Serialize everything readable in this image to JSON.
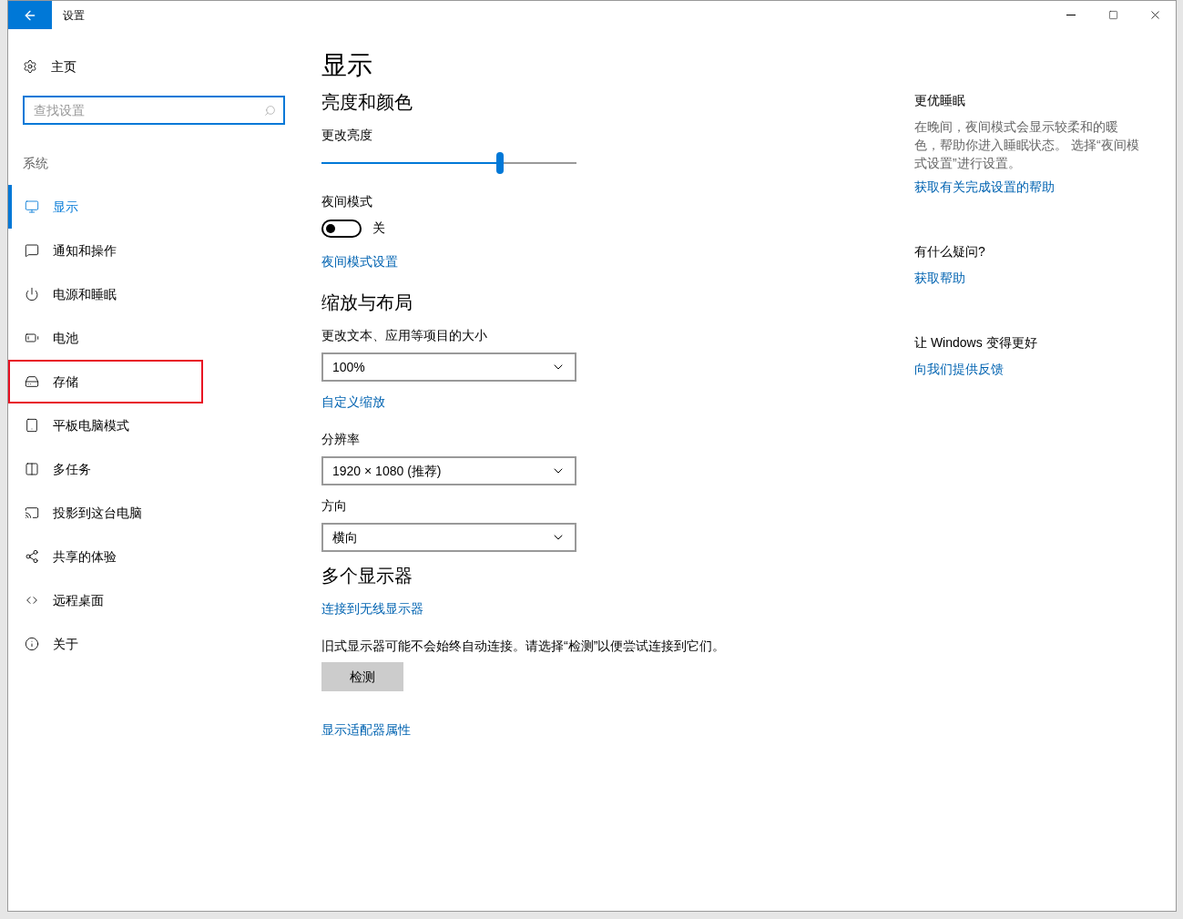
{
  "window": {
    "title": "设置"
  },
  "sidebar": {
    "home": "主页",
    "search": {
      "placeholder": "查找设置"
    },
    "section": "系统",
    "items": [
      {
        "label": "显示",
        "selected": true,
        "highlighted": false
      },
      {
        "label": "通知和操作",
        "selected": false,
        "highlighted": false
      },
      {
        "label": "电源和睡眠",
        "selected": false,
        "highlighted": false
      },
      {
        "label": "电池",
        "selected": false,
        "highlighted": false
      },
      {
        "label": "存储",
        "selected": false,
        "highlighted": true
      },
      {
        "label": "平板电脑模式",
        "selected": false,
        "highlighted": false
      },
      {
        "label": "多任务",
        "selected": false,
        "highlighted": false
      },
      {
        "label": "投影到这台电脑",
        "selected": false,
        "highlighted": false
      },
      {
        "label": "共享的体验",
        "selected": false,
        "highlighted": false
      },
      {
        "label": "远程桌面",
        "selected": false,
        "highlighted": false
      },
      {
        "label": "关于",
        "selected": false,
        "highlighted": false
      }
    ]
  },
  "main": {
    "title": "显示",
    "sections": [
      {
        "heading": "亮度和颜色",
        "controls": [
          {
            "kind": "slider",
            "label": "更改亮度",
            "level": 0.7
          },
          {
            "kind": "toggle",
            "label": "夜间模式",
            "on": false,
            "state_text": "关"
          },
          {
            "kind": "link",
            "label": "夜间模式设置"
          }
        ]
      },
      {
        "heading": "缩放与布局",
        "controls": [
          {
            "kind": "dropdown",
            "label": "更改文本、应用等项目的大小",
            "value": "100%"
          },
          {
            "kind": "link",
            "label": "自定义缩放"
          },
          {
            "kind": "dropdown",
            "label": "分辨率",
            "value": "1920 × 1080 (推荐)"
          },
          {
            "kind": "dropdown",
            "label": "方向",
            "value": "横向"
          }
        ]
      },
      {
        "heading": "多个显示器",
        "controls": [
          {
            "kind": "link",
            "label": "连接到无线显示器"
          },
          {
            "kind": "text",
            "label": "旧式显示器可能不会始终自动连接。请选择“检测”以便尝试连接到它们。"
          },
          {
            "kind": "button",
            "label": "检测"
          },
          {
            "kind": "link",
            "label": "显示适配器属性"
          }
        ]
      }
    ]
  },
  "aside": [
    {
      "heading": "更优睡眠",
      "text": "在晚间，夜间模式会显示较柔和的暖色，帮助你进入睡眠状态。 选择“夜间模式设置”进行设置。",
      "link": "获取有关完成设置的帮助"
    },
    {
      "heading": "有什么疑问?",
      "link": "获取帮助"
    },
    {
      "heading": "让 Windows 变得更好",
      "link": "向我们提供反馈"
    }
  ]
}
